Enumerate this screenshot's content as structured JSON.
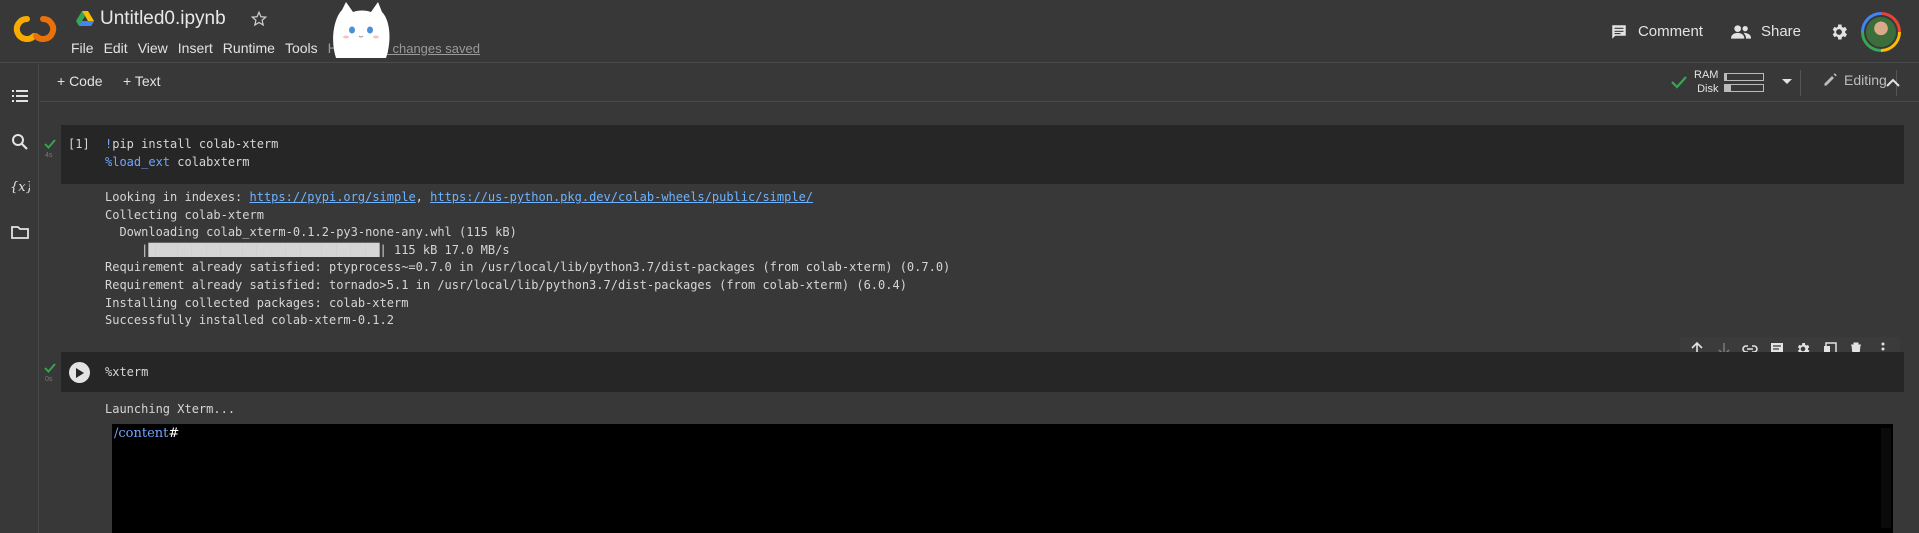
{
  "header": {
    "title": "Untitled0.ipynb",
    "menu": [
      "File",
      "Edit",
      "View",
      "Insert",
      "Runtime",
      "Tools",
      "Help"
    ],
    "save_status": "All changes saved",
    "comment_label": "Comment",
    "share_label": "Share"
  },
  "toolbar": {
    "add_code": "+ Code",
    "add_text": "+ Text",
    "ram_label": "RAM",
    "disk_label": "Disk",
    "ram_usage": 0.05,
    "disk_usage": 0.15,
    "editing_label": "Editing"
  },
  "cells": [
    {
      "execution_count": "[1]",
      "runtime": "4s",
      "code": [
        "!pip install colab-xterm",
        "%load_ext colabxterm"
      ],
      "output": {
        "line1_prefix": "Looking in indexes: ",
        "link1": "https://pypi.org/simple",
        "sep": ", ",
        "link2": "https://us-python.pkg.dev/colab-wheels/public/simple/",
        "lines": [
          "Collecting colab-xterm",
          "  Downloading colab_xterm-0.1.2-py3-none-any.whl (115 kB)",
          "     |████████████████████████████████| 115 kB 17.0 MB/s",
          "Requirement already satisfied: ptyprocess~=0.7.0 in /usr/local/lib/python3.7/dist-packages (from colab-xterm) (0.7.0)",
          "Requirement already satisfied: tornado>5.1 in /usr/local/lib/python3.7/dist-packages (from colab-xterm) (6.0.4)",
          "Installing collected packages: colab-xterm",
          "Successfully installed colab-xterm-0.1.2"
        ]
      }
    },
    {
      "runtime": "0s",
      "code": "%xterm",
      "output": "Launching Xterm...",
      "terminal_prompt": "/content",
      "terminal_cursor": "#"
    }
  ],
  "colors": {
    "background": "#383838",
    "cell_bg": "#262626",
    "link": "#6fb3ff",
    "success": "#34a853",
    "terminal_bg": "#000000"
  },
  "icons": {
    "rail": [
      "toc-icon",
      "search-icon",
      "variables-icon",
      "folder-icon"
    ],
    "cell_tools": [
      "arrow-up-icon",
      "arrow-down-icon",
      "link-icon",
      "comment-icon",
      "settings-icon",
      "mirror-cell-icon",
      "delete-icon",
      "more-vert-icon"
    ]
  }
}
